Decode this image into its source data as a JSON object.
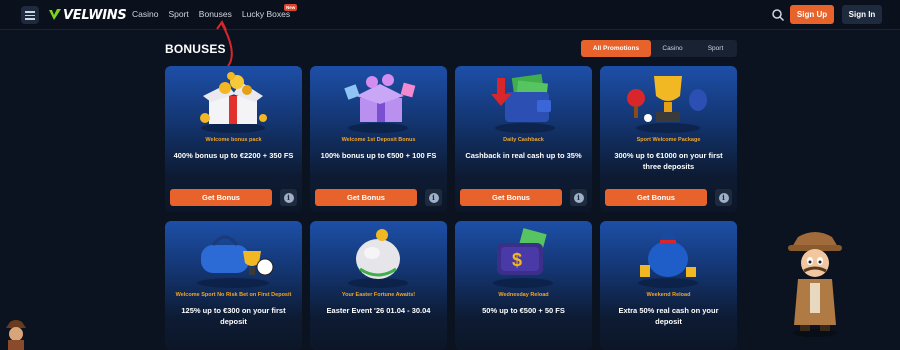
{
  "header": {
    "logo_text": "VELWINS",
    "nav": [
      "Casino",
      "Sport",
      "Bonuses",
      "Lucky Boxes"
    ],
    "new_badge": "New",
    "signup_label": "Sign Up",
    "signin_label": "Sign In"
  },
  "page": {
    "title": "BONUSES",
    "tabs": [
      "All Promotions",
      "Casino",
      "Sport"
    ],
    "active_tab": "All Promotions"
  },
  "cards": [
    {
      "tag": "Welcome bonus pack",
      "title": "400% bonus up to €2200 + 350 FS",
      "button": "Get Bonus",
      "icon": "gift-box-icon"
    },
    {
      "tag": "Welcome 1st Deposit Bonus",
      "title": "100% bonus up to €500 + 100 FS",
      "button": "Get Bonus",
      "icon": "gift-box-purple-icon"
    },
    {
      "tag": "Daily Cashback",
      "title": "Cashback in real cash up to 35%",
      "button": "Get Bonus",
      "icon": "wallet-icon"
    },
    {
      "tag": "Sport Welcome Package",
      "title": "300% up to €1000 on your first three deposits",
      "button": "Get Bonus",
      "icon": "trophy-icon"
    },
    {
      "tag": "Welcome Sport No Risk Bet on First Deposit",
      "title": "125% up to €300 on your first deposit",
      "button": "Get Bonus",
      "icon": "sports-bag-icon"
    },
    {
      "tag": "Your Easter Fortune Awaits!",
      "title": "Easter Event '26 01.04 - 30.04",
      "button": "Get Bonus",
      "icon": "easter-egg-icon"
    },
    {
      "tag": "Wednesday Reload",
      "title": "50% up to €500 + 50 FS",
      "button": "Get Bonus",
      "icon": "dollar-wallet-icon"
    },
    {
      "tag": "Weekend Reload",
      "title": "Extra 50% real cash on your deposit",
      "button": "Get Bonus",
      "icon": "money-bag-icon"
    }
  ],
  "colors": {
    "accent": "#e8632b",
    "tag": "#f6a623",
    "bg": "#0c1320",
    "annotation_arrow": "#d8262b"
  }
}
